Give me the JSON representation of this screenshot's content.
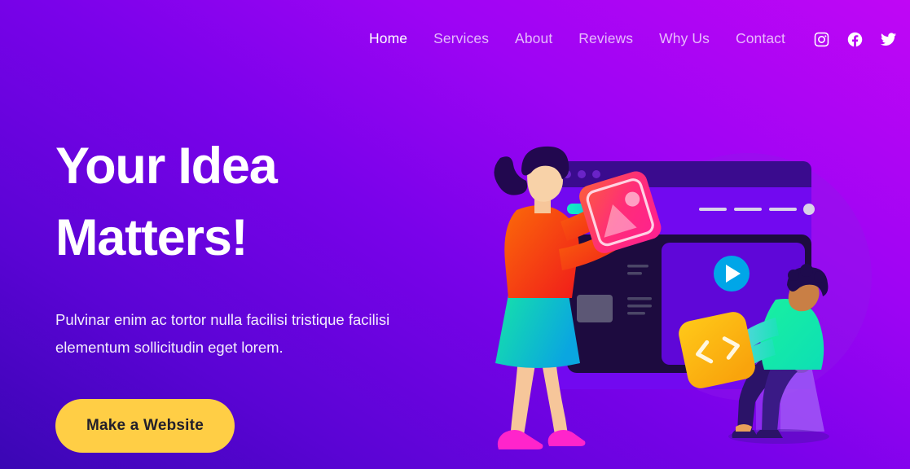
{
  "header": {
    "nav": [
      {
        "label": "Home",
        "active": true
      },
      {
        "label": "Services",
        "active": false
      },
      {
        "label": "About",
        "active": false
      },
      {
        "label": "Reviews",
        "active": false
      },
      {
        "label": "Why Us",
        "active": false
      },
      {
        "label": "Contact",
        "active": false
      }
    ],
    "socials": [
      {
        "name": "instagram-icon",
        "label": "Instagram"
      },
      {
        "name": "facebook-icon",
        "label": "Facebook"
      },
      {
        "name": "twitter-icon",
        "label": "Twitter"
      }
    ]
  },
  "hero": {
    "headline_line1": "Your Idea",
    "headline_line2": "Matters!",
    "subtitle": "Pulvinar enim ac tortor nulla facilisi tristique facilisi elementum sollicitudin eget lorem.",
    "cta_label": "Make a Website"
  },
  "illustration": {
    "name": "team-building-website-illustration",
    "browser_window": {
      "dots": 3,
      "logo_pill": "cyan-gradient-pill",
      "nav_dashes": 3,
      "avatar_dot": "gray-circle"
    },
    "media_card": {
      "name": "image-card",
      "icon": "picture-icon"
    },
    "code_card": {
      "name": "code-card",
      "icon": "code-brackets-icon"
    },
    "play_button": {
      "name": "play-button-icon"
    },
    "figures": [
      {
        "name": "woman-figure",
        "holding": "image-card"
      },
      {
        "name": "man-figure",
        "holding": "code-card"
      }
    ]
  },
  "colors": {
    "gradient_start": "#3a06b4",
    "gradient_end": "#c006f5",
    "cta_bg": "#FFCE45",
    "cta_text": "#221f2b",
    "nav_active": "#ffffff",
    "nav_idle": "rgba(255,255,255,.72)",
    "panel_dark": "#1d0b3f",
    "screen_purple": "#7209f0",
    "card_pink": "#ff2d78",
    "card_yellow": "#fbb314",
    "play_blue": "#00a6e8",
    "skirt_teal": "#0ddfb5",
    "sweater_orange": "#f4511e",
    "shirt_green": "#13e89a",
    "shoe_magenta": "#ff24cb"
  }
}
